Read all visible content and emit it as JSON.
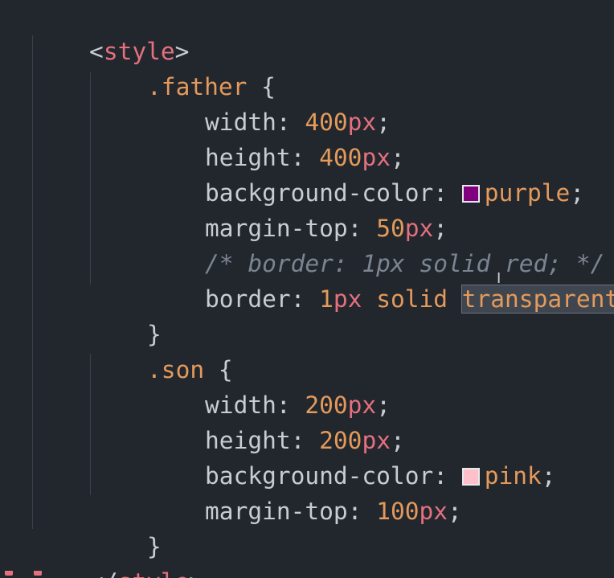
{
  "colors": {
    "background": "#22272e",
    "tag": "#e5707e",
    "selector": "#e49a5b",
    "number": "#e49a5b",
    "unit": "#e5707e",
    "comment": "#7b8591",
    "purple_swatch": "#800080",
    "pink_swatch": "#ffc0cb"
  },
  "code": {
    "style_open": {
      "lt": "<",
      "tag": "style",
      "gt": ">"
    },
    "father": {
      "selector": ".father",
      "brace_open": " {",
      "width": {
        "prop": "width: ",
        "num": "400",
        "unit": "px",
        "end": ";"
      },
      "height": {
        "prop": "height: ",
        "num": "400",
        "unit": "px",
        "end": ";"
      },
      "bg": {
        "prop": "background-color: ",
        "value": "purple",
        "end": ";"
      },
      "margin_top": {
        "prop": "margin-top: ",
        "num": "50",
        "unit": "px",
        "end": ";"
      },
      "comment": "/* border: 1px solid red; */",
      "border": {
        "prop": "border: ",
        "num": "1",
        "unit": "px",
        "kw": " solid ",
        "value": "transparent",
        "end": ";"
      },
      "brace_close": "}"
    },
    "son": {
      "selector": ".son",
      "brace_open": " {",
      "width": {
        "prop": "width: ",
        "num": "200",
        "unit": "px",
        "end": ";"
      },
      "height": {
        "prop": "height: ",
        "num": "200",
        "unit": "px",
        "end": ";"
      },
      "bg": {
        "prop": "background-color: ",
        "value": "pink",
        "end": ";"
      },
      "margin_top": {
        "prop": "margin-top: ",
        "num": "100",
        "unit": "px",
        "end": ";"
      },
      "brace_close": "}"
    },
    "style_close": {
      "lt": "</",
      "tag": "style",
      "gt": ">"
    }
  },
  "icons": {
    "text_cursor": "I-beam-cursor-icon"
  }
}
